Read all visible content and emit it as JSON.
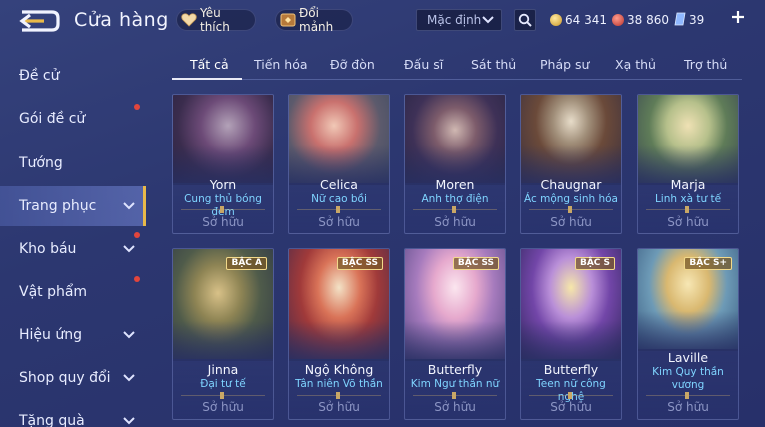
{
  "header": {
    "title": "Cửa hàng",
    "wishlist_label": "Yêu thích",
    "exchange_label": "Đổi mảnh",
    "sort_value": "Mặc định",
    "gold": "64 341",
    "voucher": "38 860",
    "quan_huy": "39"
  },
  "colors": {
    "accent": "#e9b949",
    "skin_name": "#7fd4ff",
    "red_dot": "#e2453c"
  },
  "sidebar": {
    "items": [
      {
        "label": "Đề cử"
      },
      {
        "label": "Gói đề cử"
      },
      {
        "label": "Tướng"
      },
      {
        "label": "Trang phục"
      },
      {
        "label": "Kho báu"
      },
      {
        "label": "Vật phẩm"
      },
      {
        "label": "Hiệu ứng"
      },
      {
        "label": "Shop quy đổi"
      },
      {
        "label": "Tặng quà"
      }
    ]
  },
  "tabs": [
    "Tất cả",
    "Tiến hóa",
    "Đỡ đòn",
    "Đấu sĩ",
    "Sát thủ",
    "Pháp sư",
    "Xạ thủ",
    "Trợ thủ"
  ],
  "cards": [
    {
      "hero": "Yorn",
      "skin": "Cung thủ bóng đêm",
      "status": "Sở hữu"
    },
    {
      "hero": "Celica",
      "skin": "Nữ cao bồi",
      "status": "Sở hữu"
    },
    {
      "hero": "Moren",
      "skin": "Anh thợ điện",
      "status": "Sở hữu"
    },
    {
      "hero": "Chaugnar",
      "skin": "Ác mộng sinh hóa",
      "status": "Sở hữu"
    },
    {
      "hero": "Marja",
      "skin": "Linh xà tư tế",
      "status": "Sở hữu"
    },
    {
      "hero": "Jinna",
      "skin": "Đại tư tế",
      "status": "Sở hữu",
      "tier": "BẬC A"
    },
    {
      "hero": "Ngộ Không",
      "skin": "Tân niên Võ thần",
      "status": "Sở hữu",
      "tier": "BẬC SS"
    },
    {
      "hero": "Butterfly",
      "skin": "Kim Ngư thần nữ",
      "status": "Sở hữu",
      "tier": "BẬC SS"
    },
    {
      "hero": "Butterfly",
      "skin": "Teen nữ công nghệ",
      "status": "Sở hữu",
      "tier": "BẬC S"
    },
    {
      "hero": "Laville",
      "skin": "Kim Quy thần vương",
      "status": "Sở hữu",
      "tier": "BẬC S+"
    }
  ]
}
